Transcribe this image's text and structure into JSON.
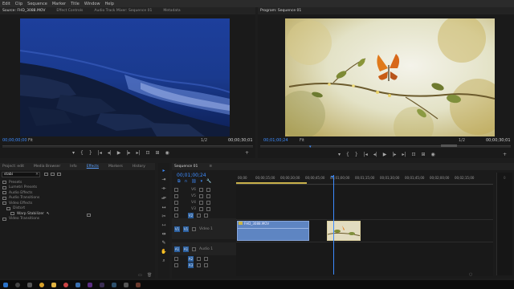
{
  "menu": [
    "Edit",
    "Clip",
    "Sequence",
    "Marker",
    "Title",
    "Window",
    "Help"
  ],
  "source_tabs": [
    "Source: FHD_3088.MOV",
    "Effect Controls",
    "Audio Track Mixer: Sequence 01",
    "Metadata"
  ],
  "source_monitor": {
    "timecode_left": "00;00;00;00",
    "fit": "Fit",
    "ratio": "1/2",
    "timecode_right": "00;00;30;01"
  },
  "program_monitor": {
    "tab": "Program: Sequence 01",
    "timecode_left": "00;01;00;24",
    "fit": "Fit",
    "ratio": "1/2",
    "timecode_right": "00;00;30;01"
  },
  "project_tabs": [
    "Project: edit",
    "Media Browser",
    "Info",
    "Effects",
    "Markers",
    "History"
  ],
  "effects_search": "stabi",
  "effects_tree": [
    "Presets",
    "Lumetri Presets",
    "Audio Effects",
    "Audio Transitions",
    "Video Effects",
    "Distort",
    "Warp Stabilizer",
    "Video Transitions"
  ],
  "sequence": {
    "tab": "Sequence 01",
    "timecode": "00;01;00;24"
  },
  "ruler": [
    "00;00",
    "00;00;15;00",
    "00;00;30;00",
    "00;00;45;00",
    "00;01;00;00",
    "00;01;15;00",
    "00;01;30;00",
    "00;01;45;00",
    "00;02;00;00",
    "00;02;15;00"
  ],
  "video_tracks": [
    "V6",
    "V5",
    "V4",
    "V3",
    "V2",
    "V1"
  ],
  "audio_tracks": [
    "A1",
    "A2",
    "A3"
  ],
  "clips": {
    "v1_clip1": "FHD_3088.MOV",
    "v1_track_name": "Video 1",
    "a1_track_name": "Audio 1"
  },
  "colors": {
    "accent": "#2f79e6",
    "clip": "#5e85c2",
    "bg": "#1d1d1d",
    "track_blue": "#2b5f9e"
  }
}
